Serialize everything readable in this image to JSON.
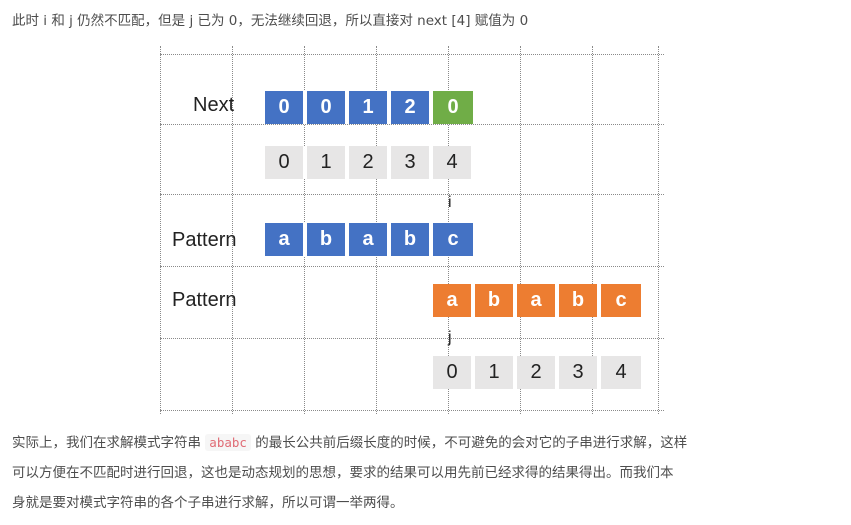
{
  "intro_text": "此时 i 和 j 仍然不匹配，但是 j 已为 0，无法继续回退，所以直接对 next [4] 赋值为 0",
  "diagram": {
    "next_label": "Next",
    "next_values": [
      "0",
      "0",
      "1",
      "2",
      "0"
    ],
    "next_indices": [
      "0",
      "1",
      "2",
      "3",
      "4"
    ],
    "pointer_i": "i",
    "text_label": "Pattern",
    "text_chars": [
      "a",
      "b",
      "a",
      "b",
      "c"
    ],
    "pattern_label": "Pattern",
    "pattern_chars": [
      "a",
      "b",
      "a",
      "b",
      "c"
    ],
    "pointer_j": "j",
    "pattern_indices": [
      "0",
      "1",
      "2",
      "3",
      "4"
    ],
    "colors": {
      "blue": "#4472c4",
      "green": "#70ad47",
      "orange": "#ed7d31",
      "gray": "#e7e6e6"
    }
  },
  "body": {
    "before_code": "实际上，我们在求解模式字符串 ",
    "code": "ababc",
    "line1_rest": " 的最长公共前后缀长度的时候，不可避免的会对它的子串进行求解，这样",
    "line2": "可以方便在不匹配时进行回退，这也是动态规划的思想，要求的结果可以用先前已经求得的结果得出。而我们本",
    "line3": "身就是要对模式字符串的各个子串进行求解，所以可谓一举两得。"
  }
}
